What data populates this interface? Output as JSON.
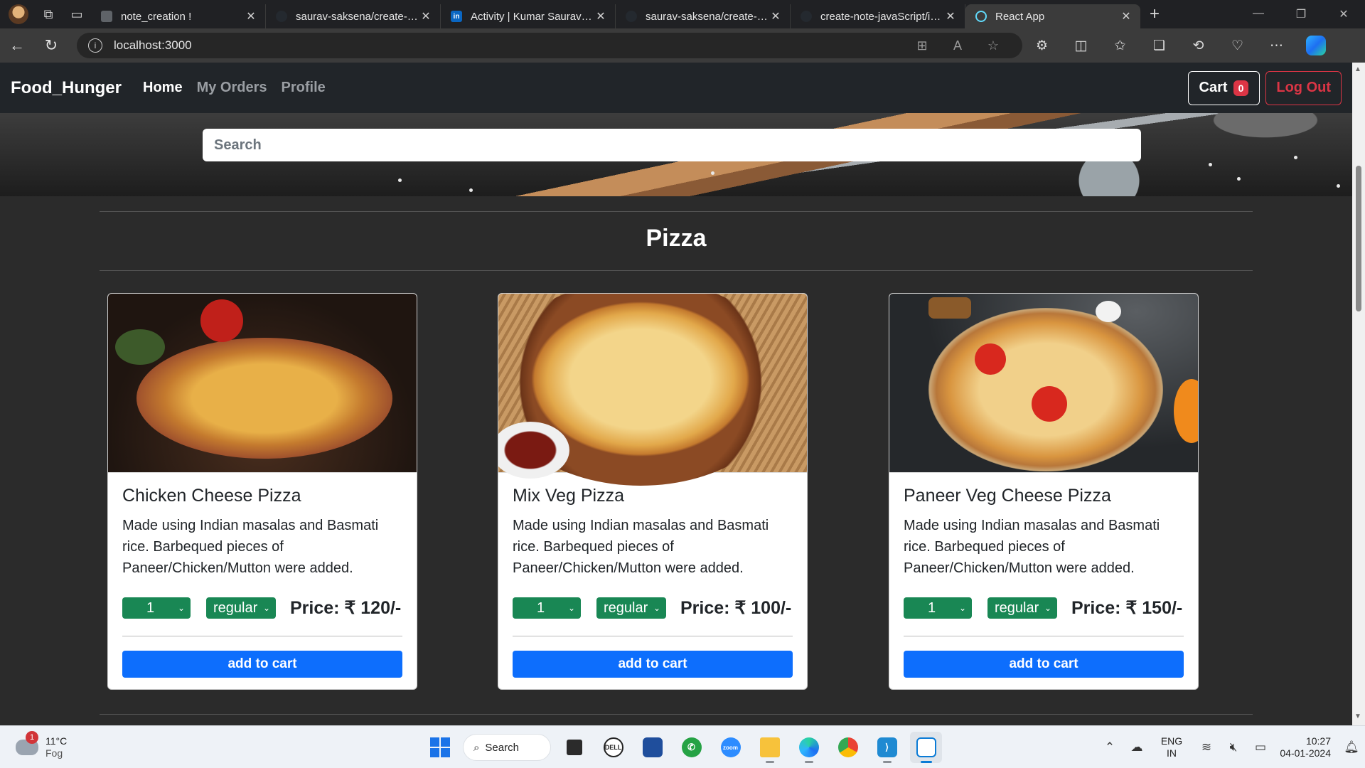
{
  "browser": {
    "tabs": [
      {
        "title": "note_creation !",
        "favicon_color": "#5f6368",
        "favicon_text": ""
      },
      {
        "title": "saurav-saksena/create-note",
        "favicon_color": "#24292f",
        "favicon_text": ""
      },
      {
        "title": "Activity | Kumar Saurav | LinkedIn",
        "favicon_color": "#0a66c2",
        "favicon_text": "in"
      },
      {
        "title": "saurav-saksena/create-note",
        "favicon_color": "#24292f",
        "favicon_text": ""
      },
      {
        "title": "create-note-javaScript/img",
        "favicon_color": "#24292f",
        "favicon_text": ""
      },
      {
        "title": "React App",
        "favicon_color": "#61dafb",
        "favicon_text": ""
      }
    ],
    "url": "localhost:3000"
  },
  "app": {
    "brand": "Food_Hunger",
    "nav": [
      {
        "label": "Home",
        "active": true
      },
      {
        "label": "My Orders",
        "active": false
      },
      {
        "label": "Profile",
        "active": false
      }
    ],
    "cart_label": "Cart",
    "cart_count": "0",
    "logout_label": "Log Out",
    "search_placeholder": "Search",
    "category_title": "Pizza",
    "cards": [
      {
        "name": "Chicken Cheese Pizza",
        "description": "Made using Indian masalas and Basmati rice. Barbequed pieces of Paneer/Chicken/Mutton were added.",
        "quantity": "1",
        "size": "regular",
        "price": "Price: ₹ 120/-",
        "button": "add to cart",
        "bg": "#3a2a22"
      },
      {
        "name": "Mix Veg Pizza",
        "description": "Made using Indian masalas and Basmati rice. Barbequed pieces of Paneer/Chicken/Mutton were added.",
        "quantity": "1",
        "size": "regular",
        "price": "Price: ₹ 100/-",
        "button": "add to cart",
        "bg": "#b58a5c"
      },
      {
        "name": "Paneer Veg Cheese Pizza",
        "description": "Made using Indian masalas and Basmati rice. Barbequed pieces of Paneer/Chicken/Mutton were added.",
        "quantity": "1",
        "size": "regular",
        "price": "Price: ₹ 150/-",
        "button": "add to cart",
        "bg": "#2a2d30"
      }
    ]
  },
  "taskbar": {
    "weather_temp": "11°C",
    "weather_desc": "Fog",
    "weather_alert": "1",
    "search_label": "Search",
    "lang_1": "ENG",
    "lang_2": "IN",
    "time": "10:27",
    "date": "04-01-2024"
  },
  "colors": {
    "primary": "#0d6efd",
    "success": "#198754",
    "danger": "#dc3545",
    "navbar": "#212529"
  }
}
